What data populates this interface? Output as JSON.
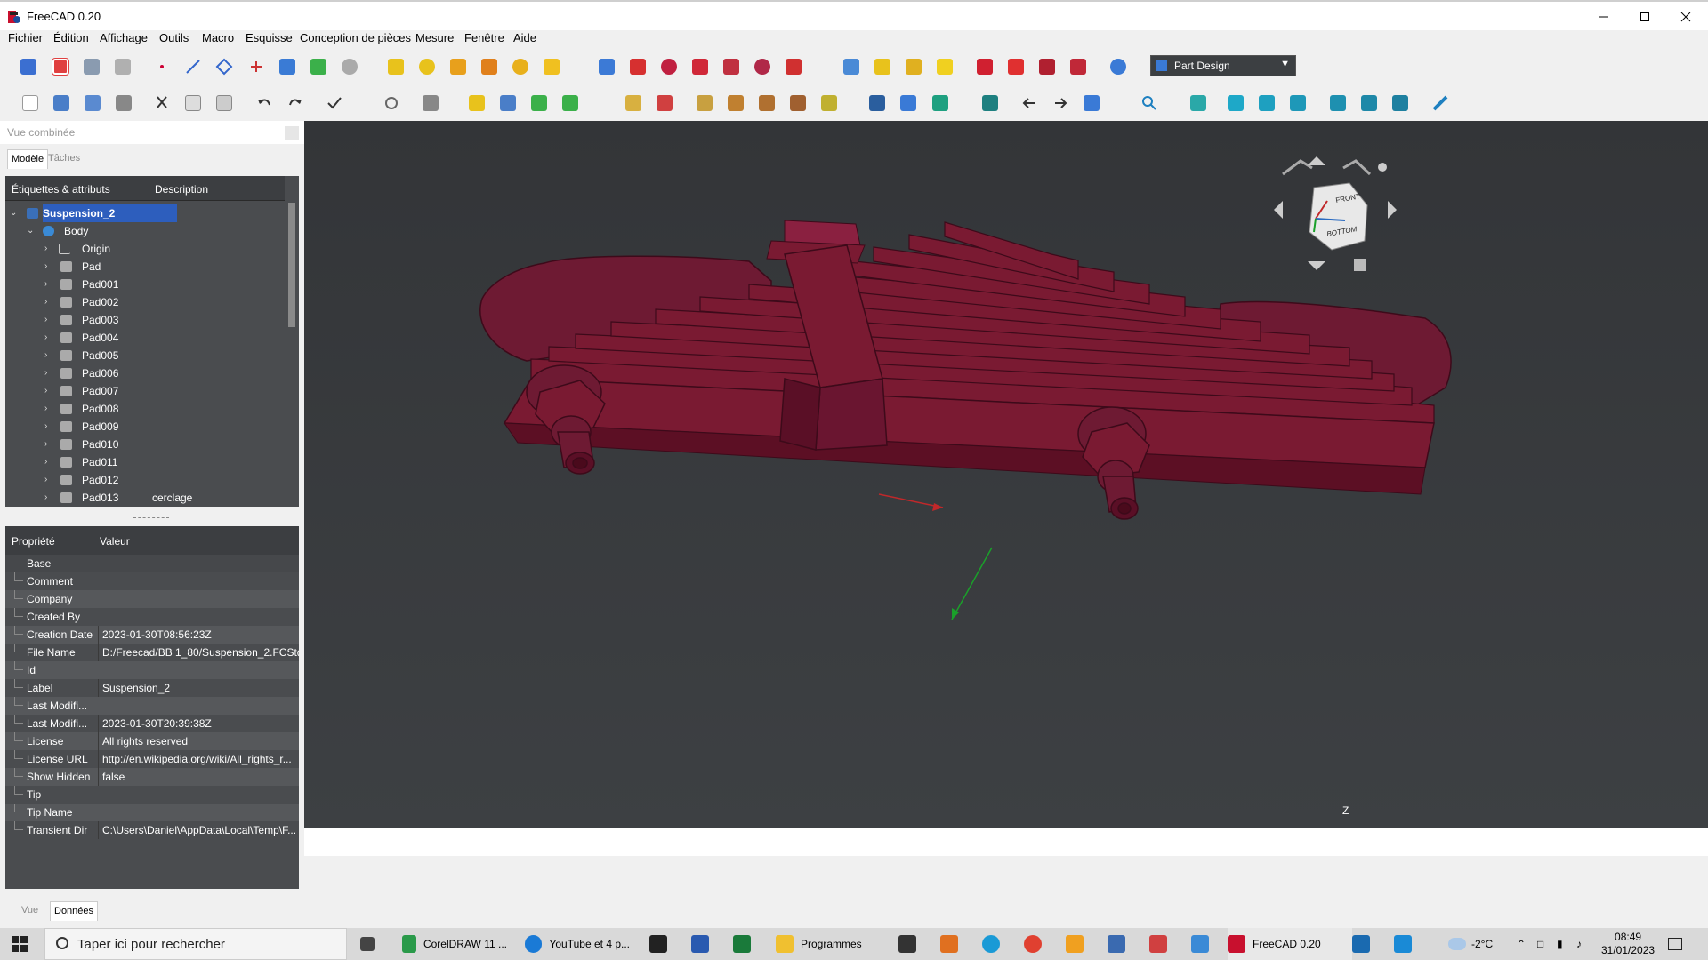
{
  "window": {
    "title": "FreeCAD 0.20"
  },
  "menu": [
    "Fichier",
    "Édition",
    "Affichage",
    "Outils",
    "Macro",
    "Esquisse",
    "Conception de pièces",
    "Mesure",
    "Fenêtre",
    "Aide"
  ],
  "workbench": {
    "selected": "Part Design"
  },
  "combo": {
    "title": "Vue combinée",
    "tabs": {
      "model": "Modèle",
      "tasks": "Tâches"
    },
    "tree_headers": {
      "labels": "Étiquettes & attributs",
      "description": "Description"
    },
    "tree_items": [
      {
        "label": "Suspension_2",
        "desc": ""
      },
      {
        "label": "Body",
        "desc": ""
      },
      {
        "label": "Origin",
        "desc": ""
      },
      {
        "label": "Pad",
        "desc": ""
      },
      {
        "label": "Pad001",
        "desc": ""
      },
      {
        "label": "Pad002",
        "desc": ""
      },
      {
        "label": "Pad003",
        "desc": ""
      },
      {
        "label": "Pad004",
        "desc": ""
      },
      {
        "label": "Pad005",
        "desc": ""
      },
      {
        "label": "Pad006",
        "desc": ""
      },
      {
        "label": "Pad007",
        "desc": ""
      },
      {
        "label": "Pad008",
        "desc": ""
      },
      {
        "label": "Pad009",
        "desc": ""
      },
      {
        "label": "Pad010",
        "desc": ""
      },
      {
        "label": "Pad011",
        "desc": ""
      },
      {
        "label": "Pad012",
        "desc": ""
      },
      {
        "label": "Pad013",
        "desc": "cerclage"
      }
    ],
    "prop_headers": {
      "property": "Propriété",
      "value": "Valeur"
    },
    "prop_group": "Base",
    "properties": [
      {
        "name": "Comment",
        "value": ""
      },
      {
        "name": "Company",
        "value": ""
      },
      {
        "name": "Created By",
        "value": ""
      },
      {
        "name": "Creation Date",
        "value": "2023-01-30T08:56:23Z"
      },
      {
        "name": "File Name",
        "value": "D:/Freecad/BB 1_80/Suspension_2.FCStd"
      },
      {
        "name": "Id",
        "value": ""
      },
      {
        "name": "Label",
        "value": "Suspension_2"
      },
      {
        "name": "Last Modifi...",
        "value": ""
      },
      {
        "name": "Last Modifi...",
        "value": "2023-01-30T20:39:38Z"
      },
      {
        "name": "License",
        "value": "All rights reserved"
      },
      {
        "name": "License URL",
        "value": "http://en.wikipedia.org/wiki/All_rights_r..."
      },
      {
        "name": "Show Hidden",
        "value": "false"
      },
      {
        "name": "Tip",
        "value": ""
      },
      {
        "name": "Tip Name",
        "value": ""
      },
      {
        "name": "Transient Dir",
        "value": "C:\\Users\\Daniel\\AppData\\Local\\Temp\\F..."
      }
    ],
    "bottom_tabs": {
      "view": "Vue",
      "data": "Données"
    }
  },
  "navcube": {
    "front": "FRONT",
    "bottom": "BOTTOM"
  },
  "axis_label": "Z",
  "taskbar": {
    "search_placeholder": "Taper ici pour rechercher",
    "apps": [
      "CorelDRAW 11 ...",
      "YouTube et 4 p...",
      "Programmes",
      "FreeCAD 0.20"
    ],
    "weather": "-2°C",
    "time": "08:49",
    "date": "31/01/2023"
  },
  "colors": {
    "model": "#7a1a32",
    "selection": "#2d5ebd",
    "viewport": "#3a3c3f"
  }
}
